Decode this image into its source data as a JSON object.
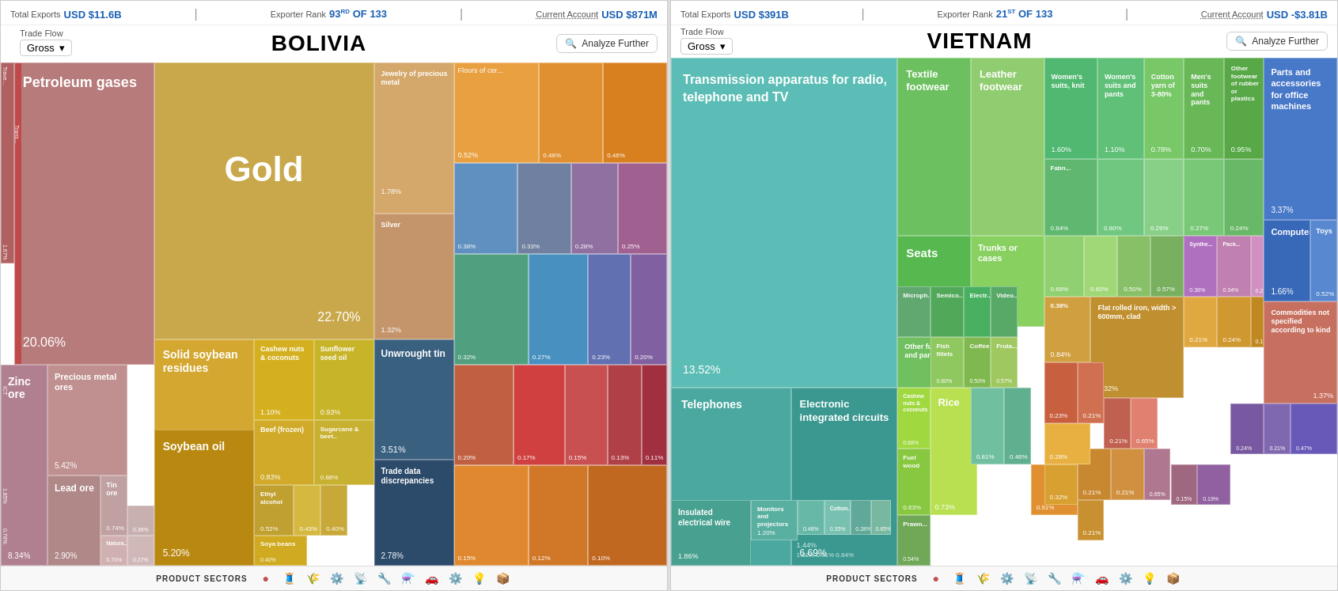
{
  "bolivia": {
    "total_exports_label": "Total Exports",
    "total_exports_value": "USD $11.6B",
    "exporter_rank_label": "Exporter Rank",
    "exporter_rank_value": "93",
    "exporter_rank_suffix": "RD",
    "exporter_rank_total": "OF 133",
    "current_account_label": "Current Account",
    "current_account_value": "USD $871M",
    "country_title": "BOLIVIA",
    "trade_flow_label": "Trade Flow",
    "trade_flow_value": "Gross",
    "analyze_further_label": "Analyze Further",
    "product_sectors_label": "PRODUCT SECTORS"
  },
  "vietnam": {
    "total_exports_label": "Total Exports",
    "total_exports_value": "USD $391B",
    "exporter_rank_label": "Exporter Rank",
    "exporter_rank_value": "21",
    "exporter_rank_suffix": "ST",
    "exporter_rank_total": "OF 133",
    "current_account_label": "Current Account",
    "current_account_value": "USD -$3.81B",
    "country_title": "VIETNAM",
    "trade_flow_label": "Trade Flow",
    "trade_flow_value": "Gross",
    "analyze_further_label": "Analyze Further",
    "product_sectors_label": "PRODUCT SECTORS"
  },
  "legend_icons": [
    "🔴",
    "🧵",
    "🌾",
    "⚙️",
    "📡",
    "🔧",
    "⚗️",
    "🚗",
    "⚙️",
    "💡",
    "📦"
  ]
}
